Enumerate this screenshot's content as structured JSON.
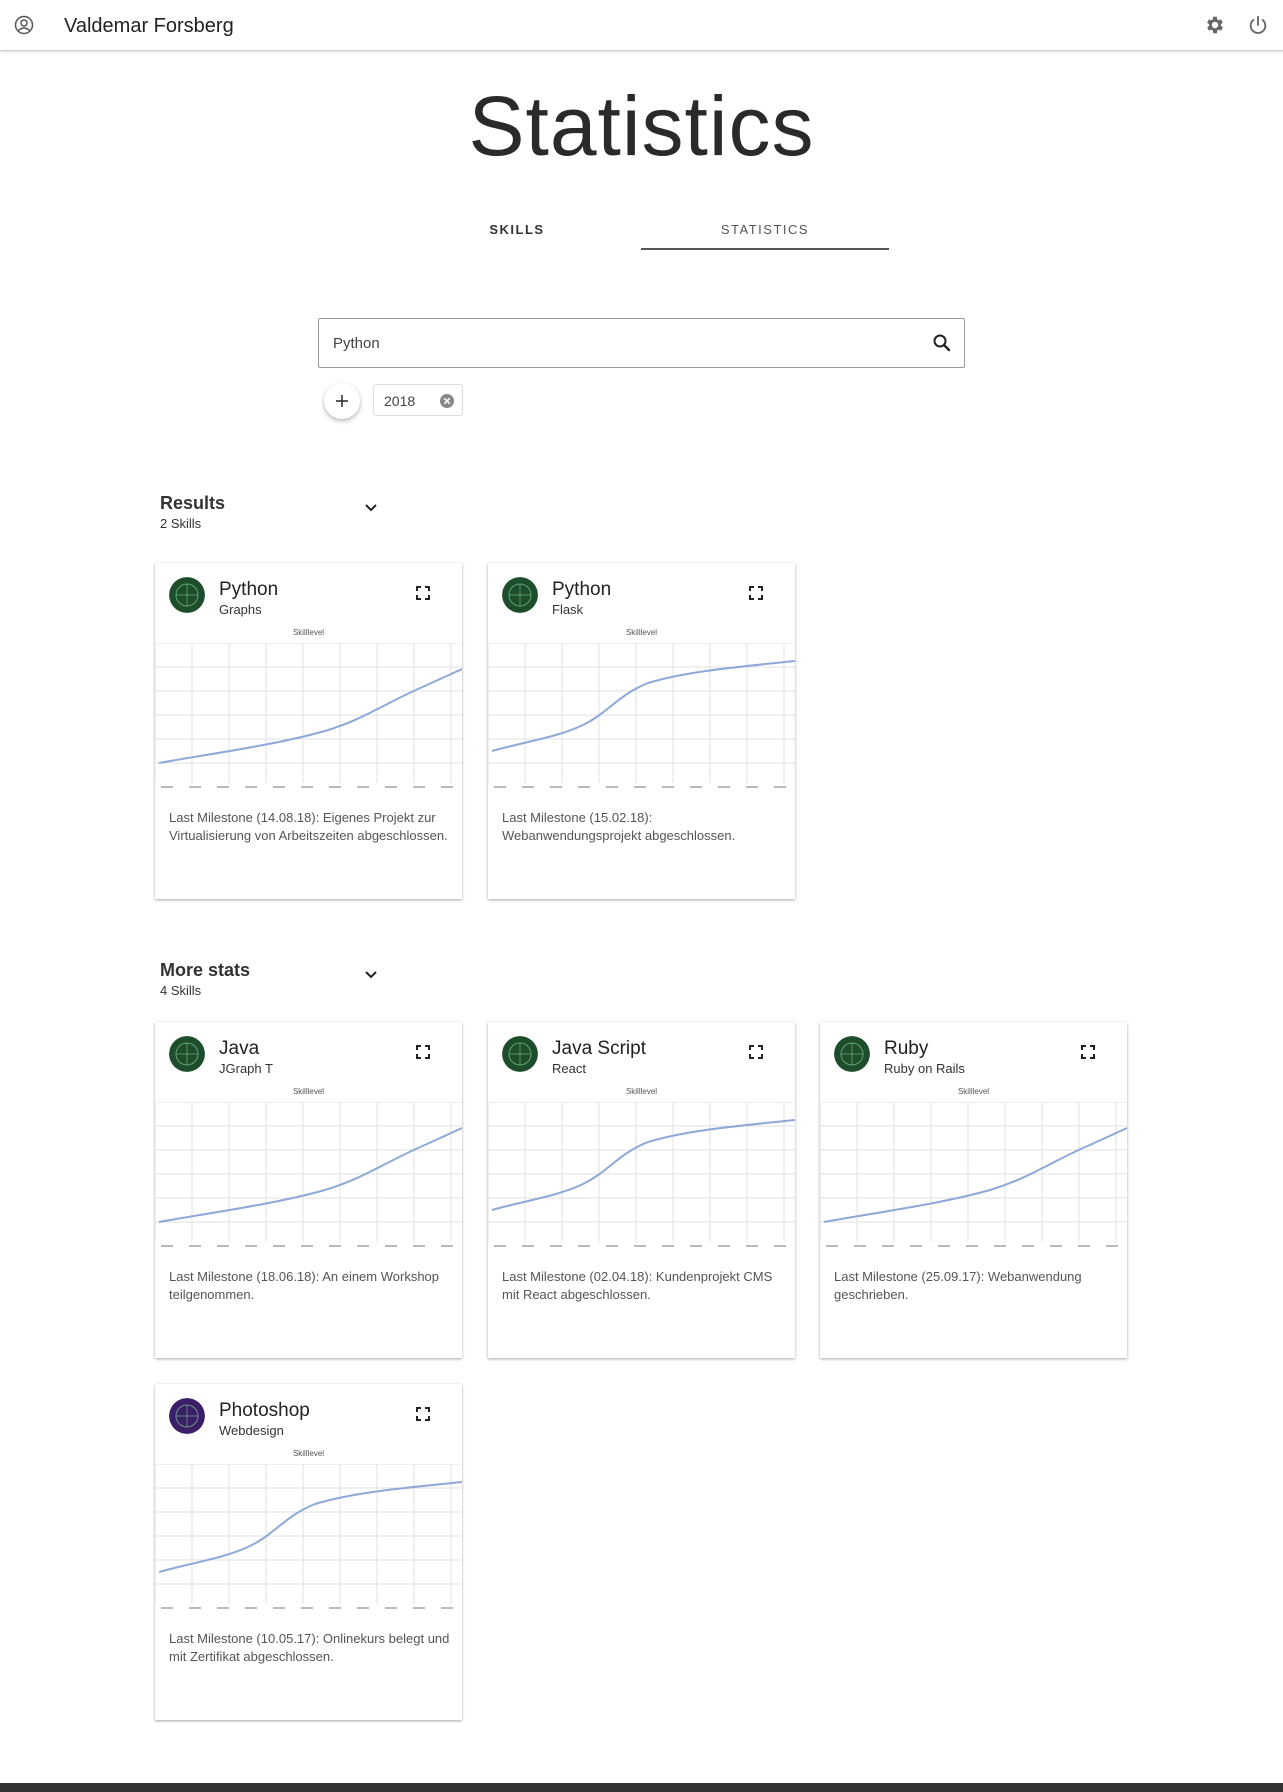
{
  "header": {
    "username": "Valdemar Forsberg"
  },
  "page": {
    "title": "Statistics"
  },
  "tabs": [
    {
      "label": "SKILLS"
    },
    {
      "label": "STATISTICS"
    }
  ],
  "search": {
    "value": "Python"
  },
  "filter_chip": {
    "label": "2018"
  },
  "sections": [
    {
      "title": "Results",
      "count": "2 Skills"
    },
    {
      "title": "More stats",
      "count": "4 Skills"
    }
  ],
  "chart_title": "Skilllevel",
  "colors": {
    "line": "#8ea9d8",
    "grid": "#e0e0e0",
    "avatar_green": "#1e4d2b",
    "avatar_purple": "#3a1f66"
  },
  "cards": [
    {
      "name": "Python",
      "sub": "Graphs",
      "milestone": "Last Milestone (14.08.18): Eigenes Projekt zur Virtualisierung von Arbeitszeiten abgeschlossen.",
      "avatar": "green"
    },
    {
      "name": "Python",
      "sub": "Flask",
      "milestone": "Last Milestone (15.02.18): Webanwendungsprojekt abgeschlossen.",
      "avatar": "green"
    },
    {
      "name": "Java",
      "sub": "JGraph T",
      "milestone": "Last Milestone (18.06.18): An einem Workshop teilgenommen.",
      "avatar": "green"
    },
    {
      "name": "Java Script",
      "sub": "React",
      "milestone": "Last Milestone (02.04.18): Kundenprojekt CMS mit React abgeschlossen.",
      "avatar": "green"
    },
    {
      "name": "Ruby",
      "sub": "Ruby on Rails",
      "milestone": "Last Milestone (25.09.17): Webanwendung geschrieben.",
      "avatar": "green"
    },
    {
      "name": "Photoshop",
      "sub": "Webdesign",
      "milestone": "Last Milestone (10.05.17): Onlinekurs belegt und mit Zertifikat abgeschlossen.",
      "avatar": "purple"
    }
  ]
}
